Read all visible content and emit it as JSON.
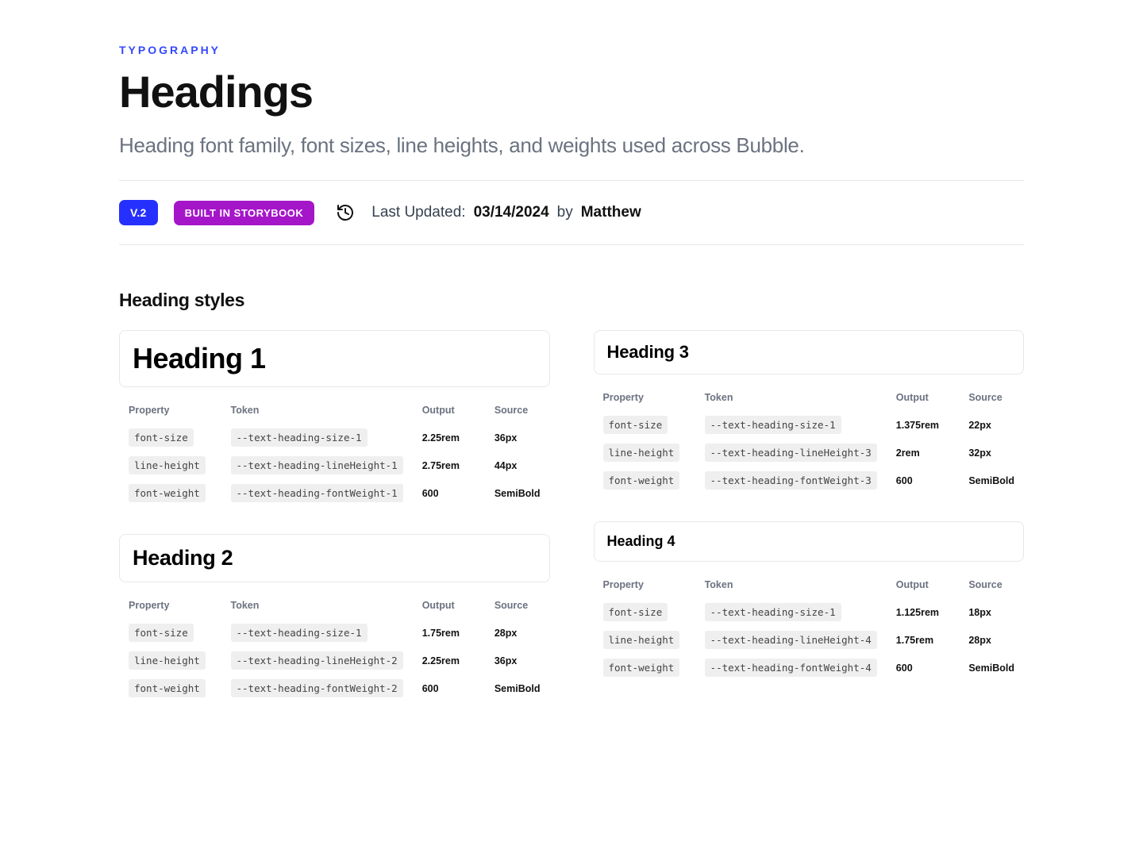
{
  "eyebrow": "TYPOGRAPHY",
  "title": "Headings",
  "description": "Heading font family, font sizes, line heights, and weights used across Bubble.",
  "badges": {
    "version": "V.2",
    "storybook": "BUILT IN STORYBOOK"
  },
  "meta": {
    "lastUpdatedLabel": "Last Updated:",
    "date": "03/14/2024",
    "byLabel": "by",
    "author": "Matthew"
  },
  "sectionTitle": "Heading styles",
  "columns": {
    "property": "Property",
    "token": "Token",
    "output": "Output",
    "source": "Source"
  },
  "headings": [
    {
      "label": "Heading 1",
      "class": "heading-1",
      "rows": [
        {
          "property": "font-size",
          "token": "--text-heading-size-1",
          "output": "2.25rem",
          "source": "36px"
        },
        {
          "property": "line-height",
          "token": "--text-heading-lineHeight-1",
          "output": "2.75rem",
          "source": "44px"
        },
        {
          "property": "font-weight",
          "token": "--text-heading-fontWeight-1",
          "output": "600",
          "source": "SemiBold"
        }
      ]
    },
    {
      "label": "Heading 2",
      "class": "heading-2",
      "rows": [
        {
          "property": "font-size",
          "token": "--text-heading-size-1",
          "output": "1.75rem",
          "source": "28px"
        },
        {
          "property": "line-height",
          "token": "--text-heading-lineHeight-2",
          "output": "2.25rem",
          "source": "36px"
        },
        {
          "property": "font-weight",
          "token": "--text-heading-fontWeight-2",
          "output": "600",
          "source": "SemiBold"
        }
      ]
    },
    {
      "label": "Heading 3",
      "class": "heading-3",
      "rows": [
        {
          "property": "font-size",
          "token": "--text-heading-size-1",
          "output": "1.375rem",
          "source": "22px"
        },
        {
          "property": "line-height",
          "token": "--text-heading-lineHeight-3",
          "output": "2rem",
          "source": "32px"
        },
        {
          "property": "font-weight",
          "token": "--text-heading-fontWeight-3",
          "output": "600",
          "source": "SemiBold"
        }
      ]
    },
    {
      "label": "Heading 4",
      "class": "heading-4",
      "rows": [
        {
          "property": "font-size",
          "token": "--text-heading-size-1",
          "output": "1.125rem",
          "source": "18px"
        },
        {
          "property": "line-height",
          "token": "--text-heading-lineHeight-4",
          "output": "1.75rem",
          "source": "28px"
        },
        {
          "property": "font-weight",
          "token": "--text-heading-fontWeight-4",
          "output": "600",
          "source": "SemiBold"
        }
      ]
    }
  ]
}
